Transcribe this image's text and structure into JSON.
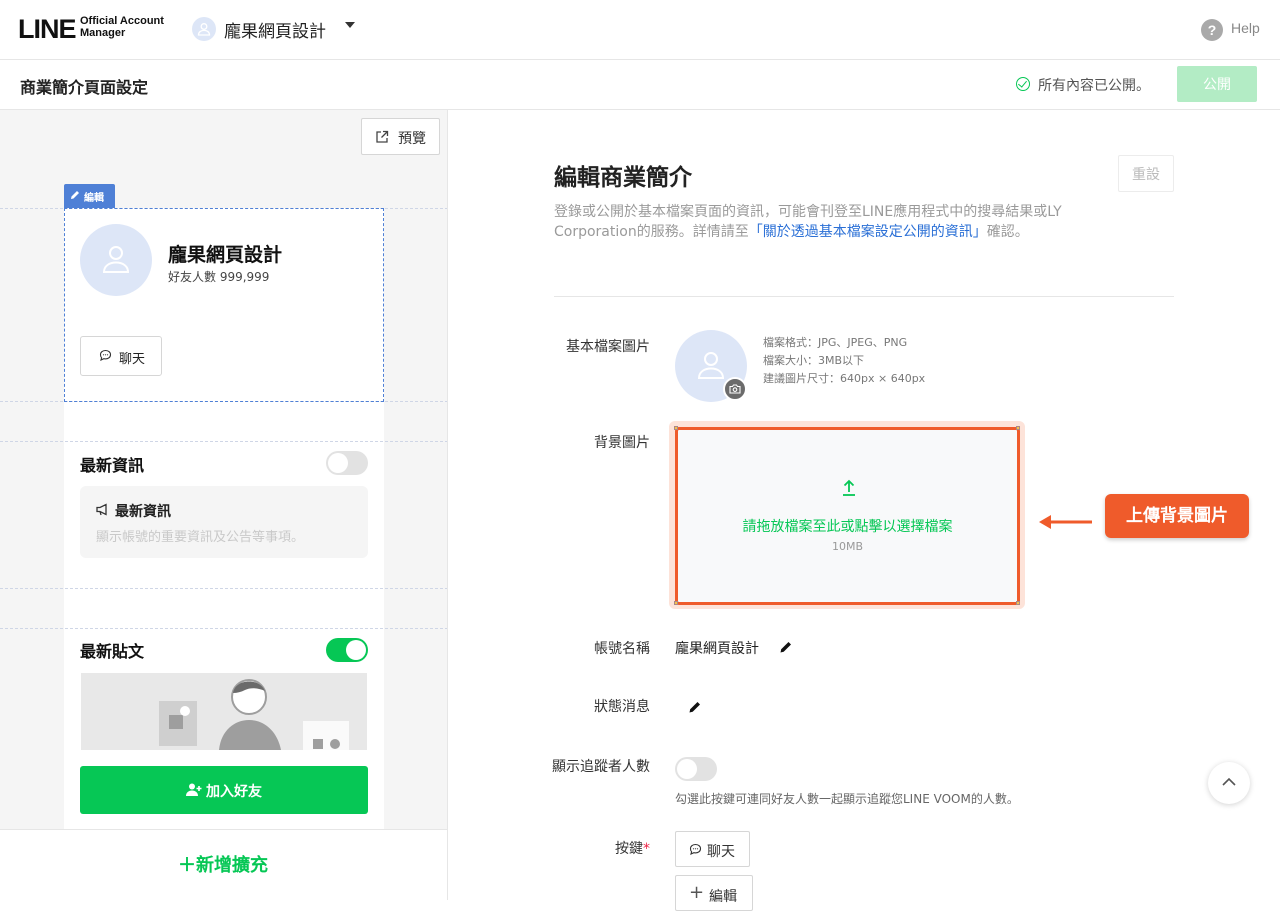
{
  "header": {
    "logo_main": "LINE",
    "logo_sub": "Official Account Manager",
    "account_name": "龐果網頁設計",
    "help_label": "Help"
  },
  "subheader": {
    "title": "商業簡介頁面設定",
    "status": "所有內容已公開。",
    "publish_label": "公開",
    "status_color": "#06c755"
  },
  "preview": {
    "preview_label": "預覽",
    "edit_tag": "編輯",
    "profile_name": "龐果網頁設計",
    "friends": "好友人數 999,999",
    "chat_label": "聊天",
    "news_section": "最新資訊",
    "news_toggle_on": false,
    "news_card_title": "最新資訊",
    "news_card_desc": "顯示帳號的重要資訊及公告等事項。",
    "posts_section": "最新貼文",
    "posts_toggle_on": true,
    "add_friend_label": "加入好友",
    "add_extension_label": "＋新增擴充"
  },
  "editor": {
    "title": "編輯商業簡介",
    "reset_label": "重設",
    "intro_before": "登錄或公開於基本檔案頁面的資訊，可能會刊登至LINE應用程式中的搜尋結果或LY Corporation的服務。詳情請至",
    "intro_link": "「關於透過基本檔案設定公開的資訊」",
    "intro_after": "確認。",
    "profile_image_label": "基本檔案圖片",
    "spec_format": "檔案格式：JPG、JPEG、PNG",
    "spec_size": "檔案大小：3MB以下",
    "spec_dim": "建議圖片尺寸：640px × 640px",
    "bg_image_label": "背景圖片",
    "upload_text": "請拖放檔案至此或點擊以選擇檔案",
    "upload_limit": "10MB",
    "callout": "上傳背景圖片",
    "account_name_label": "帳號名稱",
    "account_name_value": "龐果網頁設計",
    "status_msg_label": "狀態消息",
    "follower_label": "顯示追蹤者人數",
    "follower_toggle_on": false,
    "follower_note": "勾選此按鍵可連同好友人數一起顯示追蹤您LINE VOOM的人數。",
    "buttons_label": "按鍵",
    "required_mark": "*",
    "chat_button": "聊天",
    "edit_button": "編輯",
    "accent_color": "#ef5b2b"
  }
}
